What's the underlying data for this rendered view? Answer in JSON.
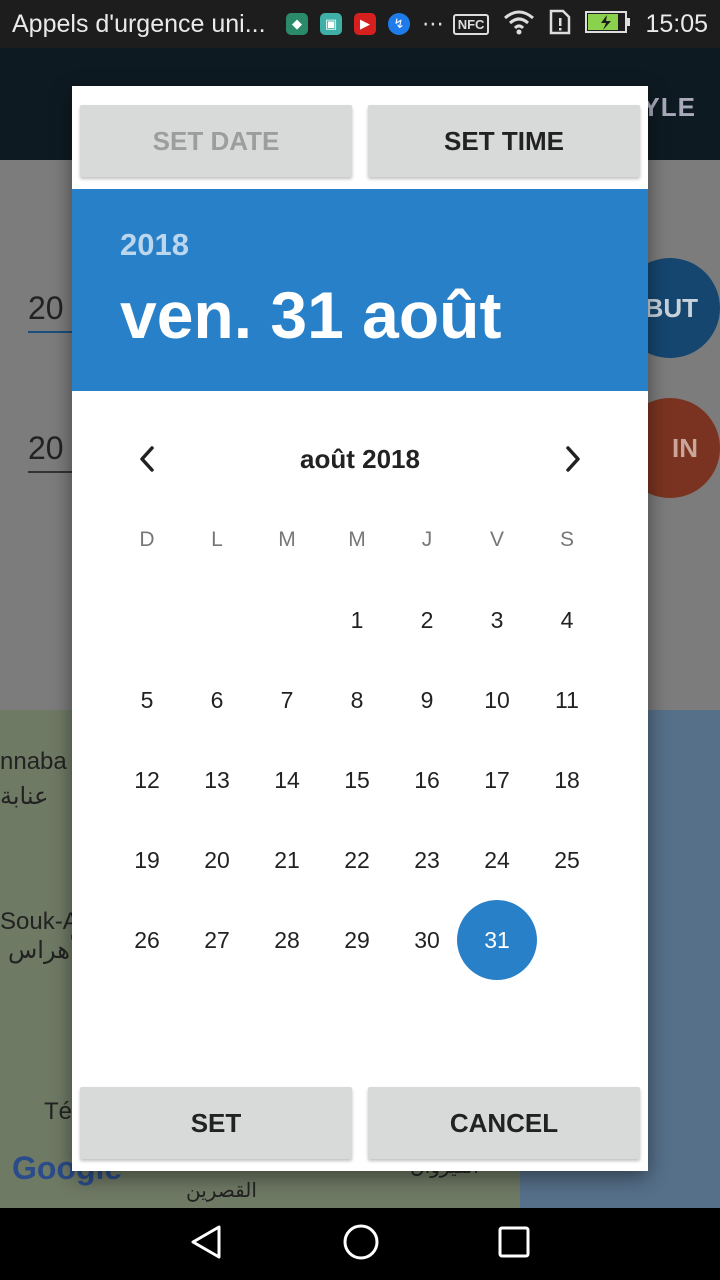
{
  "status_bar": {
    "app_title": "Appels d'urgence uni...",
    "nfc": "NFC",
    "time": "15:05"
  },
  "background": {
    "appbar_partial": "YLE",
    "input_1_partial": "20",
    "input_2_partial": "20",
    "circle_1_partial": "BUT",
    "circle_2_partial": "IN",
    "map_labels": [
      "nnaba",
      "عنابة",
      "Souk-A",
      "أهراس",
      "Té",
      "القصرين",
      "القيروان"
    ],
    "google": "Google"
  },
  "dialog": {
    "set_date_label": "SET DATE",
    "set_time_label": "SET TIME",
    "header_year": "2018",
    "header_date": "ven. 31 août",
    "month_title": "août 2018",
    "weekdays": [
      "D",
      "L",
      "M",
      "M",
      "J",
      "V",
      "S"
    ],
    "weeks": [
      [
        "",
        "",
        "",
        "1",
        "2",
        "3",
        "4"
      ],
      [
        "5",
        "6",
        "7",
        "8",
        "9",
        "10",
        "11"
      ],
      [
        "12",
        "13",
        "14",
        "15",
        "16",
        "17",
        "18"
      ],
      [
        "19",
        "20",
        "21",
        "22",
        "23",
        "24",
        "25"
      ],
      [
        "26",
        "27",
        "28",
        "29",
        "30",
        "31",
        ""
      ]
    ],
    "selected_day": "31",
    "set_label": "SET",
    "cancel_label": "CANCEL"
  },
  "colors": {
    "accent": "#2880c8",
    "button_bg": "#d8d9d9"
  }
}
